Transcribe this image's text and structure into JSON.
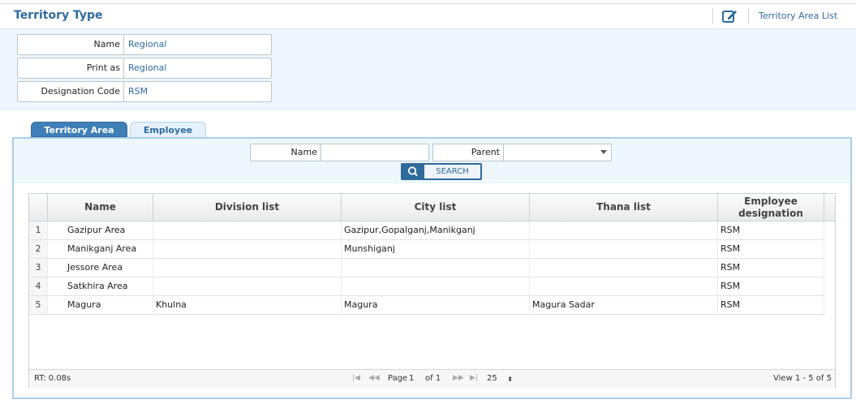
{
  "header": {
    "title": "Territory Type",
    "edit_icon": "edit-icon",
    "area_list_link": "Territory Area List"
  },
  "form": {
    "name_label": "Name",
    "name_value": "Regional",
    "print_label": "Print as",
    "print_value": "Regional",
    "designation_label": "Designation Code",
    "designation_value": "RSM"
  },
  "tabs": [
    {
      "label": "Territory Area",
      "active": true
    },
    {
      "label": "Employee",
      "active": false
    }
  ],
  "filter": {
    "name_label": "Name",
    "name_value": "",
    "parent_label": "Parent",
    "parent_value": "",
    "search_label": "SEARCH",
    "search_icon": "search-icon"
  },
  "grid": {
    "columns": [
      "Name",
      "Division list",
      "City list",
      "Thana list",
      "Employee designation"
    ],
    "rows": [
      {
        "n": "1",
        "name": "Gazipur Area",
        "division": "",
        "city": "Gazipur,Gopalganj,Manikganj",
        "thana": "",
        "designation": "RSM"
      },
      {
        "n": "2",
        "name": "Manikganj Area",
        "division": "",
        "city": "Munshiganj",
        "thana": "",
        "designation": "RSM"
      },
      {
        "n": "3",
        "name": "Jessore Area",
        "division": "",
        "city": "",
        "thana": "",
        "designation": "RSM"
      },
      {
        "n": "4",
        "name": "Satkhira Area",
        "division": "",
        "city": "",
        "thana": "",
        "designation": "RSM"
      },
      {
        "n": "5",
        "name": "Magura",
        "division": "Khulna",
        "city": "Magura",
        "thana": "Magura Sadar",
        "designation": "RSM"
      }
    ]
  },
  "pager": {
    "rt": "RT: 0.08s",
    "first": "|◀",
    "prev": "◀◀",
    "page_label": "Page",
    "page_value": "1",
    "of_label": "of 1",
    "next": "▶▶",
    "last": "▶|",
    "page_size": "25",
    "view_info": "View 1 - 5 of 5"
  },
  "colors": {
    "accent": "#2e6b9c",
    "panel_bg": "#eef7fc",
    "tab_active": "#3f7fb8",
    "panel_border": "#a9cfe9"
  }
}
